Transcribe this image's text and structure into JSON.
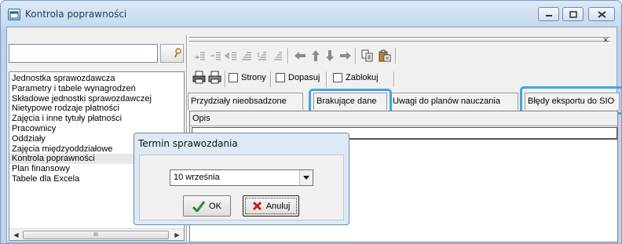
{
  "window": {
    "title": "Kontrola poprawności"
  },
  "colors": {
    "highlight": "#3ea8dc",
    "titlebar": "#c9dcf0",
    "accent_red": "#c0201a",
    "accent_green": "#2d8a2a"
  },
  "search": {
    "value": "",
    "placeholder": ""
  },
  "sidebar": {
    "items": [
      {
        "label": "Jednostka sprawozdawcza"
      },
      {
        "label": "Parametry i tabele wynagrodzeń"
      },
      {
        "label": "Składowe jednostki sprawozdawczej"
      },
      {
        "label": "Nietypowe rodzaje płatności"
      },
      {
        "label": "Zajęcia i inne tytuły płatności"
      },
      {
        "label": "Pracownicy"
      },
      {
        "label": "Oddziały"
      },
      {
        "label": "Zajęcia międzyoddziałowe"
      },
      {
        "label": "Kontrola poprawności"
      },
      {
        "label": "Plan finansowy"
      },
      {
        "label": "Tabele dla Excela"
      }
    ],
    "selected": "Kontrola poprawności",
    "scroll_thumb_glyph": "III"
  },
  "toolbar2": {
    "options": [
      {
        "label": "Strony"
      },
      {
        "label": "Dopasuj"
      },
      {
        "label": "Zablokuj"
      }
    ]
  },
  "tabs": [
    {
      "label": "Przydziały nieobsadzone"
    },
    {
      "label": "Brakujące dane"
    },
    {
      "label": "Uwagi do planów nauczania"
    },
    {
      "label": "Błędy eksportu do SIO"
    }
  ],
  "grid": {
    "columns": [
      "Opis"
    ]
  },
  "dialog": {
    "title": "Termin sprawozdania",
    "select_value": "10 września",
    "ok_label": "OK",
    "cancel_label": "Anuluj"
  },
  "icons": [
    "app-window-icon",
    "minimize-icon",
    "maximize-icon",
    "close-icon",
    "search-icon",
    "insert-row-icon",
    "insert-after-icon",
    "insert-before-icon",
    "append-icon",
    "move-up-icon",
    "move-down-icon",
    "arrow-left-icon",
    "arrow-up-icon",
    "arrow-down-icon",
    "arrow-right-icon",
    "copy-icon",
    "paste-icon",
    "print-preview-icon",
    "print-icon",
    "checkmark-icon",
    "x-mark-icon",
    "chevron-down-icon"
  ]
}
